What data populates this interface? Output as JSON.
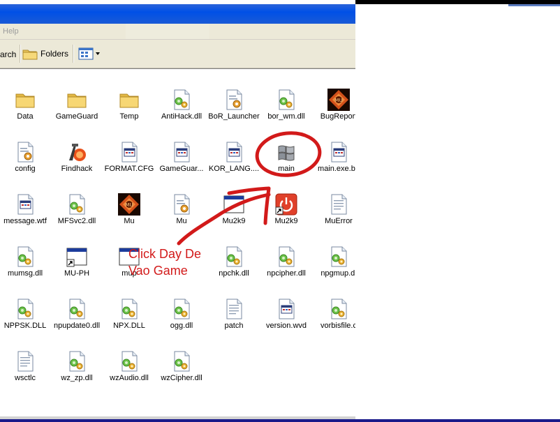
{
  "menubar": {
    "help_label": "Help"
  },
  "toolbar": {
    "search_label": "arch",
    "folders_label": "Folders",
    "views_icon": "views-icon"
  },
  "files": [
    {
      "name": "Data",
      "icon": "folder-icon"
    },
    {
      "name": "GameGuard",
      "icon": "folder-icon"
    },
    {
      "name": "Temp",
      "icon": "folder-icon"
    },
    {
      "name": "AntiHack.dll",
      "icon": "dll-icon"
    },
    {
      "name": "BoR_Launcher",
      "icon": "config-icon"
    },
    {
      "name": "bor_wm.dll",
      "icon": "dll-icon"
    },
    {
      "name": "BugReport",
      "icon": "mu-app-icon"
    },
    {
      "name": "config",
      "icon": "config-icon"
    },
    {
      "name": "Findhack",
      "icon": "findhack-icon"
    },
    {
      "name": "FORMAT.CFG",
      "icon": "cfg-icon"
    },
    {
      "name": "GameGuar...",
      "icon": "cfg-icon"
    },
    {
      "name": "KOR_LANG....",
      "icon": "cfg-icon"
    },
    {
      "name": "main",
      "icon": "windows-app-icon"
    },
    {
      "name": "main.exe.ba",
      "icon": "cfg-icon"
    },
    {
      "name": "message.wtf",
      "icon": "cfg-icon"
    },
    {
      "name": "MFSvc2.dll",
      "icon": "dll-icon"
    },
    {
      "name": "Mu",
      "icon": "mu-app-icon"
    },
    {
      "name": "Mu",
      "icon": "config-icon"
    },
    {
      "name": "Mu2k9",
      "icon": "window-icon"
    },
    {
      "name": "Mu2k9",
      "icon": "power-shortcut-icon"
    },
    {
      "name": "MuError",
      "icon": "text-icon"
    },
    {
      "name": "mumsg.dll",
      "icon": "dll-icon"
    },
    {
      "name": "MU-PH",
      "icon": "window-shortcut-icon"
    },
    {
      "name": "mup",
      "icon": "window-icon"
    },
    {
      "name": "",
      "icon": "none"
    },
    {
      "name": "npchk.dll",
      "icon": "dll-icon"
    },
    {
      "name": "npcipher.dll",
      "icon": "dll-icon"
    },
    {
      "name": "npgmup.dl",
      "icon": "dll-icon"
    },
    {
      "name": "NPPSK.DLL",
      "icon": "dll-icon"
    },
    {
      "name": "npupdate0.dll",
      "icon": "dll-icon"
    },
    {
      "name": "NPX.DLL",
      "icon": "dll-icon"
    },
    {
      "name": "ogg.dll",
      "icon": "dll-icon"
    },
    {
      "name": "patch",
      "icon": "text-icon"
    },
    {
      "name": "version.wvd",
      "icon": "cfg-icon"
    },
    {
      "name": "vorbisfile.c",
      "icon": "dll-icon"
    },
    {
      "name": "wsctlc",
      "icon": "text-icon"
    },
    {
      "name": "wz_zp.dll",
      "icon": "dll-icon"
    },
    {
      "name": "wzAudio.dll",
      "icon": "dll-icon"
    },
    {
      "name": "wzCipher.dll",
      "icon": "dll-icon"
    }
  ],
  "annotation": {
    "line1": "Click Day De",
    "line2": "Vao Game",
    "color": "#d21a1a"
  }
}
